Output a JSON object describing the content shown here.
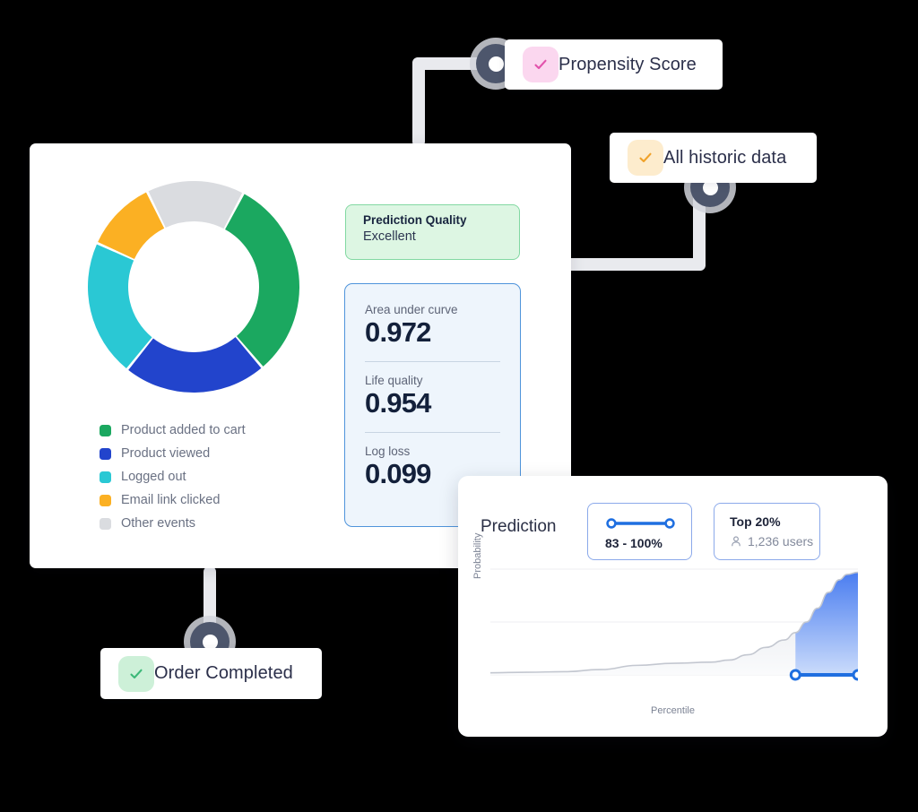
{
  "chips": [
    {
      "id": "propensity-score",
      "label": "Propensity Score",
      "icon": "check-icon",
      "tile_color": "#fbd7ef",
      "check_color": "#e251ab"
    },
    {
      "id": "all-historic-data",
      "label": "All historic data",
      "icon": "check-icon",
      "tile_color": "#fdeccd",
      "check_color": "#f0a22a"
    },
    {
      "id": "order-completed",
      "label": "Order Completed",
      "icon": "check-icon",
      "tile_color": "#cdf0d8",
      "check_color": "#38b governance"
    }
  ],
  "chip_labels": {
    "propensity": "Propensity Score",
    "historic": "All historic data",
    "order": "Order Completed"
  },
  "main_card": {
    "quality": {
      "title": "Prediction Quality",
      "value": "Excellent",
      "bg": "#ddf6e3",
      "border": "#82d8a2"
    },
    "metrics": [
      {
        "label": "Area under curve",
        "value": "0.972"
      },
      {
        "label": "Life quality",
        "value": "0.954"
      },
      {
        "label": "Log loss",
        "value": "0.099"
      }
    ]
  },
  "prediction_card": {
    "title": "Prediction",
    "range_chip": {
      "value": "83 - 100%",
      "icon": "range-slider-icon"
    },
    "top_chip": {
      "title": "Top 20%",
      "users": "1,236 users",
      "icon": "user-icon"
    },
    "xlabel": "Percentile",
    "ylabel": "Probability"
  },
  "chart_data": [
    {
      "type": "pie",
      "title": "",
      "legend_position": "bottom-left",
      "donut": true,
      "categories": [
        "Product added to cart",
        "Product viewed",
        "Logged out",
        "Email link clicked",
        "Other events"
      ],
      "values": [
        31,
        22,
        21,
        11,
        15
      ],
      "colors": [
        "#1ba860",
        "#2244cc",
        "#2ac8d4",
        "#fbb023",
        "#dadce0"
      ],
      "start_angle_deg": 28
    },
    {
      "type": "area",
      "title": "Prediction",
      "xlabel": "Percentile",
      "ylabel": "Probability",
      "xlim": [
        0,
        100
      ],
      "ylim": [
        0,
        1
      ],
      "grid": true,
      "gridlines_y": [
        0.0,
        0.5,
        1.0
      ],
      "selection": {
        "from": 83,
        "to": 100,
        "label": "83 - 100%",
        "fill": "#4a7df0"
      },
      "x": [
        0,
        10,
        20,
        30,
        40,
        50,
        60,
        65,
        70,
        75,
        80,
        83,
        86,
        89,
        92,
        95,
        97,
        100
      ],
      "y": [
        0.02,
        0.025,
        0.03,
        0.05,
        0.09,
        0.11,
        0.12,
        0.14,
        0.19,
        0.26,
        0.33,
        0.4,
        0.5,
        0.63,
        0.78,
        0.9,
        0.95,
        0.97
      ]
    }
  ]
}
